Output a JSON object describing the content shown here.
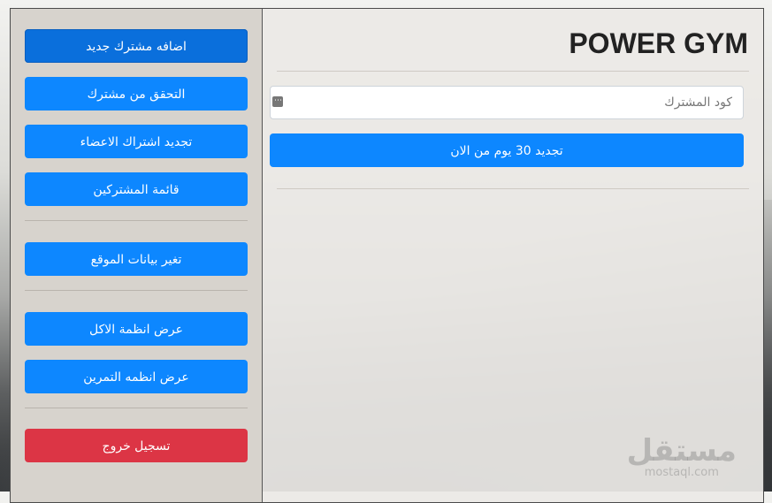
{
  "sidebar": {
    "group1": [
      "اضافه مشترك جديد",
      "التحقق من مشترك",
      "تجديد اشتراك الاعضاء",
      "قائمة المشتركين"
    ],
    "group2": [
      "تغير بيانات الموقع"
    ],
    "group3": [
      "عرض انظمة الاكل",
      "عرض انظمه التمرين"
    ],
    "logout": "تسجيل خروج"
  },
  "main": {
    "title": "POWER GYM",
    "member_code_placeholder": "كود المشترك",
    "member_code_value": "",
    "renew_button": "تجديد 30 يوم من الان"
  },
  "watermark": {
    "arabic": "مستقل",
    "latin": "mostaql.com"
  },
  "colors": {
    "primary": "#0d87ff",
    "danger": "#dc3545",
    "sidebar_bg": "#d7d3cd"
  },
  "icons": {
    "input_icon": "keyboard-icon"
  }
}
